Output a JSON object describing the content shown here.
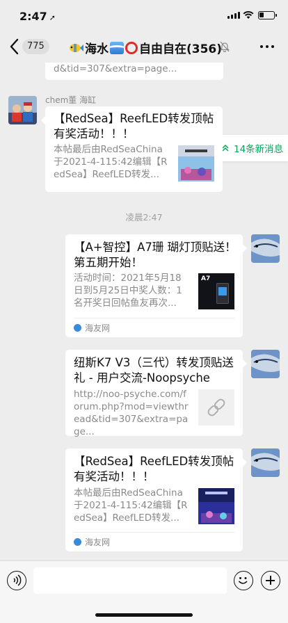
{
  "status_bar": {
    "time": "2:47"
  },
  "nav": {
    "unread_count": "775",
    "title_prefix": "海水",
    "title_suffix": "自由自在(356)"
  },
  "new_messages_label": "14条新消息",
  "top_partial_card": {
    "desc_line": "d&tid=307&extra=page..."
  },
  "sender_name": "chem董 海缸",
  "incoming_card": {
    "title": "【RedSea】ReefLED转发顶帖有奖活动！！！",
    "desc": "本帖最后由RedSeaChina于2021-4-115:42编辑【RedSea】ReefLED转发..."
  },
  "timestamp": "凌晨2:47",
  "outgoing_cards": [
    {
      "title": "【A+智控】A7珊 瑚灯顶贴送！第五期开始！",
      "desc": "活动时间：2021年5月18日到5月25日中奖人数：1名开奖日回帖鱼友再次...",
      "thumb_label": "A7",
      "source": "海友网"
    },
    {
      "title": "纽斯K7 V3（三代）转发顶贴送礼 - 用户交流-Noopsyche",
      "desc": "http://noo-psyche.com/forum.php?mod=viewthread&tid=307&extra=page..."
    },
    {
      "title": "【RedSea】ReefLED转发顶帖有奖活动！！！",
      "desc": "本帖最后由RedSeaChina于2021-4-115:42编辑【RedSea】ReefLED转发...",
      "source": "海友网"
    }
  ],
  "input": {
    "value": ""
  },
  "colors": {
    "accent_green": "#07a35a",
    "chat_bg": "#ededed",
    "bubble": "#ffffff"
  }
}
